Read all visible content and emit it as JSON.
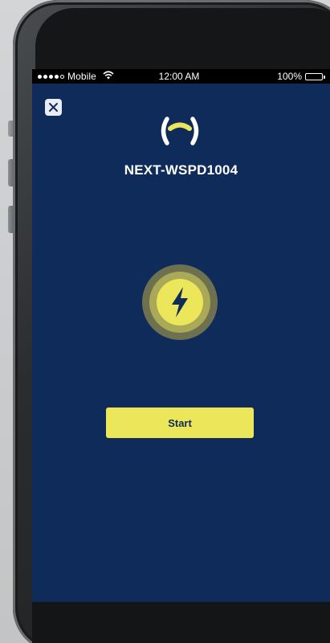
{
  "status_bar": {
    "carrier": "Mobile",
    "signal_bars_filled": 4,
    "signal_bars_total": 5,
    "time": "12:00 AM",
    "battery_percent": "100%",
    "battery_level": 1.0,
    "icons": [
      "signal-icon",
      "wifi-icon",
      "battery-icon"
    ]
  },
  "header": {
    "close_icon": "close-icon",
    "logo_icon": "brand-logo-icon",
    "device_name": "NEXT-WSPD1004"
  },
  "main": {
    "status_icon": "lightning-bolt-icon",
    "start_label": "Start"
  },
  "colors": {
    "background": "#0f2b5a",
    "accent": "#ece65a",
    "text": "#ffffff"
  }
}
